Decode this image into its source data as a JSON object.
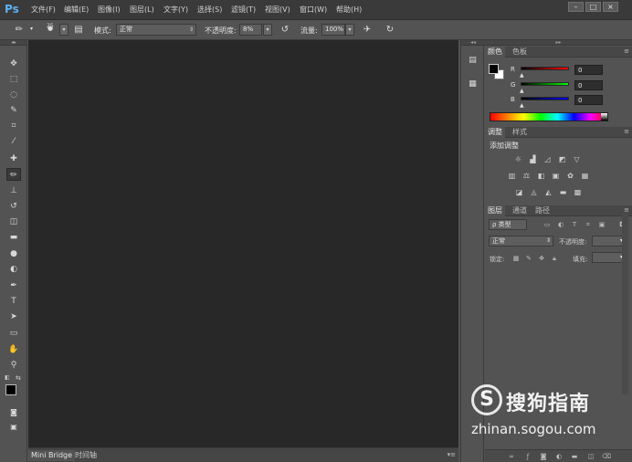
{
  "app": {
    "logo": "Ps"
  },
  "menu": [
    "文件(F)",
    "编辑(E)",
    "图像(I)",
    "图层(L)",
    "文字(Y)",
    "选择(S)",
    "滤镜(T)",
    "视图(V)",
    "窗口(W)",
    "帮助(H)"
  ],
  "window_controls": [
    "–",
    "□",
    "×"
  ],
  "options": {
    "brush_size": "25",
    "mode_label": "模式:",
    "mode_value": "正常",
    "opacity_label": "不透明度:",
    "opacity_value": "8%",
    "flow_label": "流量:",
    "flow_value": "100%"
  },
  "tools": [
    {
      "name": "move-tool-icon",
      "glyph": "✥"
    },
    {
      "name": "marquee-tool-icon",
      "glyph": "⬚"
    },
    {
      "name": "lasso-tool-icon",
      "glyph": "◌"
    },
    {
      "name": "quick-select-tool-icon",
      "glyph": "✎"
    },
    {
      "name": "crop-tool-icon",
      "glyph": "⌗"
    },
    {
      "name": "eyedropper-tool-icon",
      "glyph": "⁄"
    },
    {
      "name": "healing-brush-tool-icon",
      "glyph": "✚"
    },
    {
      "name": "brush-tool-icon",
      "glyph": "✏"
    },
    {
      "name": "clone-stamp-tool-icon",
      "glyph": "⊥"
    },
    {
      "name": "history-brush-tool-icon",
      "glyph": "↺"
    },
    {
      "name": "eraser-tool-icon",
      "glyph": "◫"
    },
    {
      "name": "gradient-tool-icon",
      "glyph": "▬"
    },
    {
      "name": "blur-tool-icon",
      "glyph": "●"
    },
    {
      "name": "dodge-tool-icon",
      "glyph": "◐"
    },
    {
      "name": "pen-tool-icon",
      "glyph": "✒"
    },
    {
      "name": "type-tool-icon",
      "glyph": "T"
    },
    {
      "name": "path-select-tool-icon",
      "glyph": "➤"
    },
    {
      "name": "rectangle-tool-icon",
      "glyph": "▭"
    },
    {
      "name": "hand-tool-icon",
      "glyph": "✋"
    },
    {
      "name": "zoom-tool-icon",
      "glyph": "⚲"
    }
  ],
  "bottom_tabs": [
    "Mini Bridge",
    "时间轴"
  ],
  "color_panel": {
    "tabs": [
      "颜色",
      "色板"
    ],
    "channels": [
      {
        "label": "R",
        "value": "0",
        "color": "#d01010"
      },
      {
        "label": "G",
        "value": "0",
        "color": "#10b010"
      },
      {
        "label": "B",
        "value": "0",
        "color": "#1010d0"
      }
    ]
  },
  "adjust_panel": {
    "tabs": [
      "调整",
      "样式"
    ],
    "add_label": "添加调整"
  },
  "layers_panel": {
    "tabs": [
      "图层",
      "通道",
      "路径"
    ],
    "kind_label": "ρ 类型",
    "blend_mode": "正常",
    "opacity_label": "不透明度:",
    "lock_label": "锁定:",
    "fill_label": "填充:"
  },
  "watermark": {
    "logo_glyph": "S",
    "text": "搜狗指南",
    "url": "zhinan.sogou.com"
  }
}
